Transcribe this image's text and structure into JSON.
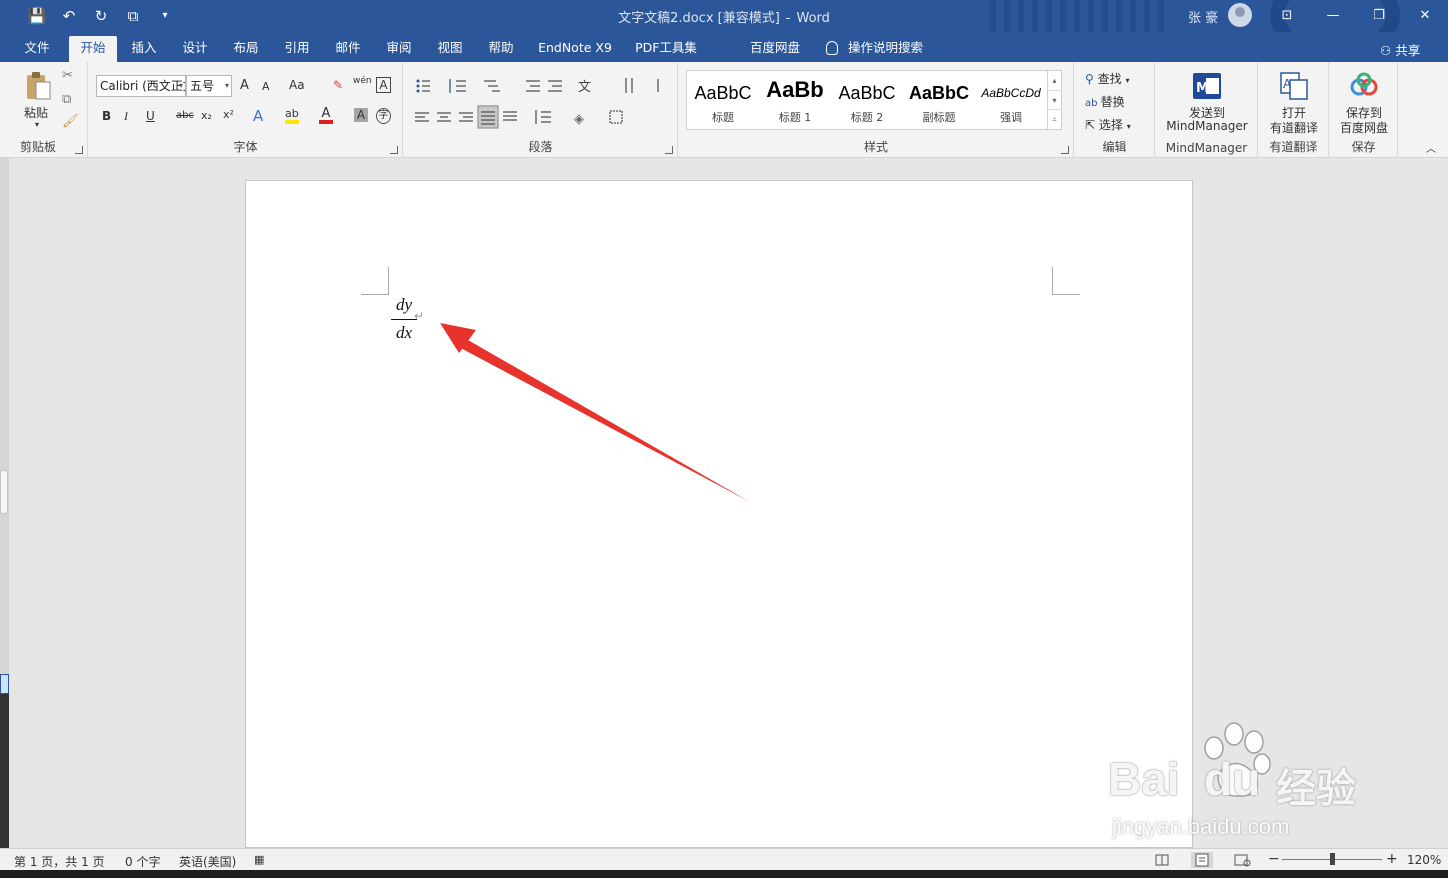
{
  "titlebar": {
    "doc_name": "文字文稿2.docx [兼容模式]",
    "separator": "-",
    "app_name": "Word",
    "user": "张 豪",
    "qat": {
      "save": "💾",
      "undo": "↶",
      "redo": "↻",
      "touch": "⧉",
      "customize": "▾"
    },
    "window_buttons": {
      "ribbon_options": "⊡",
      "minimize": "—",
      "restore": "❐",
      "close": "✕"
    }
  },
  "tabs": [
    {
      "label": "文件"
    },
    {
      "label": "开始",
      "active": true
    },
    {
      "label": "插入"
    },
    {
      "label": "设计"
    },
    {
      "label": "布局"
    },
    {
      "label": "引用"
    },
    {
      "label": "邮件"
    },
    {
      "label": "审阅"
    },
    {
      "label": "视图"
    },
    {
      "label": "帮助"
    },
    {
      "label": "EndNote X9"
    },
    {
      "label": "PDF工具集"
    },
    {
      "label": "百度网盘"
    }
  ],
  "tell_me": "操作说明搜索",
  "share": "共享",
  "ribbon": {
    "clipboard": {
      "label": "剪贴板",
      "paste": "粘贴"
    },
    "font": {
      "label": "字体",
      "font_name": "Calibri (西文正文)",
      "font_size": "五号",
      "grow": "A",
      "shrink": "A",
      "case": "Aa",
      "clear": "✎",
      "phonetic": "wén",
      "border_char": "A",
      "bold": "B",
      "italic": "I",
      "underline": "U",
      "strike": "abc",
      "sub": "x₂",
      "sup": "x²",
      "effects": "A",
      "highlight": "ab",
      "color": "A",
      "shade": "A",
      "enclose": "字"
    },
    "paragraph": {
      "label": "段落"
    },
    "styles": {
      "label": "样式",
      "items": [
        {
          "sample": "AaBbC",
          "name": "标题"
        },
        {
          "sample": "AaBb",
          "name": "标题 1"
        },
        {
          "sample": "AaBbC",
          "name": "标题 2"
        },
        {
          "sample": "AaBbC",
          "name": "副标题"
        },
        {
          "sample": "AaBbCcDd",
          "name": "强调"
        }
      ]
    },
    "editing": {
      "label": "编辑",
      "find": "查找",
      "replace": "替换",
      "select": "选择"
    },
    "mindmanager": {
      "label": "MindManager",
      "button": "发送到",
      "button2": "MindManager"
    },
    "youdao": {
      "label": "有道翻译",
      "button": "打开",
      "button2": "有道翻译"
    },
    "baidu": {
      "label": "保存",
      "button": "保存到",
      "button2": "百度网盘"
    }
  },
  "document": {
    "equation": {
      "numerator": "dy",
      "denominator": "dx"
    },
    "paragraph_mark": "↵"
  },
  "watermark": {
    "logo": "Bai",
    "logo2": "du",
    "cn": "经验",
    "url": "jingyan.baidu.com"
  },
  "status": {
    "page": "第 1 页，共 1 页",
    "words": "0 个字",
    "language": "英语(美国)",
    "zoom_minus": "−",
    "zoom_plus": "+",
    "zoom": "120%",
    "zoom_level": 0.5
  }
}
